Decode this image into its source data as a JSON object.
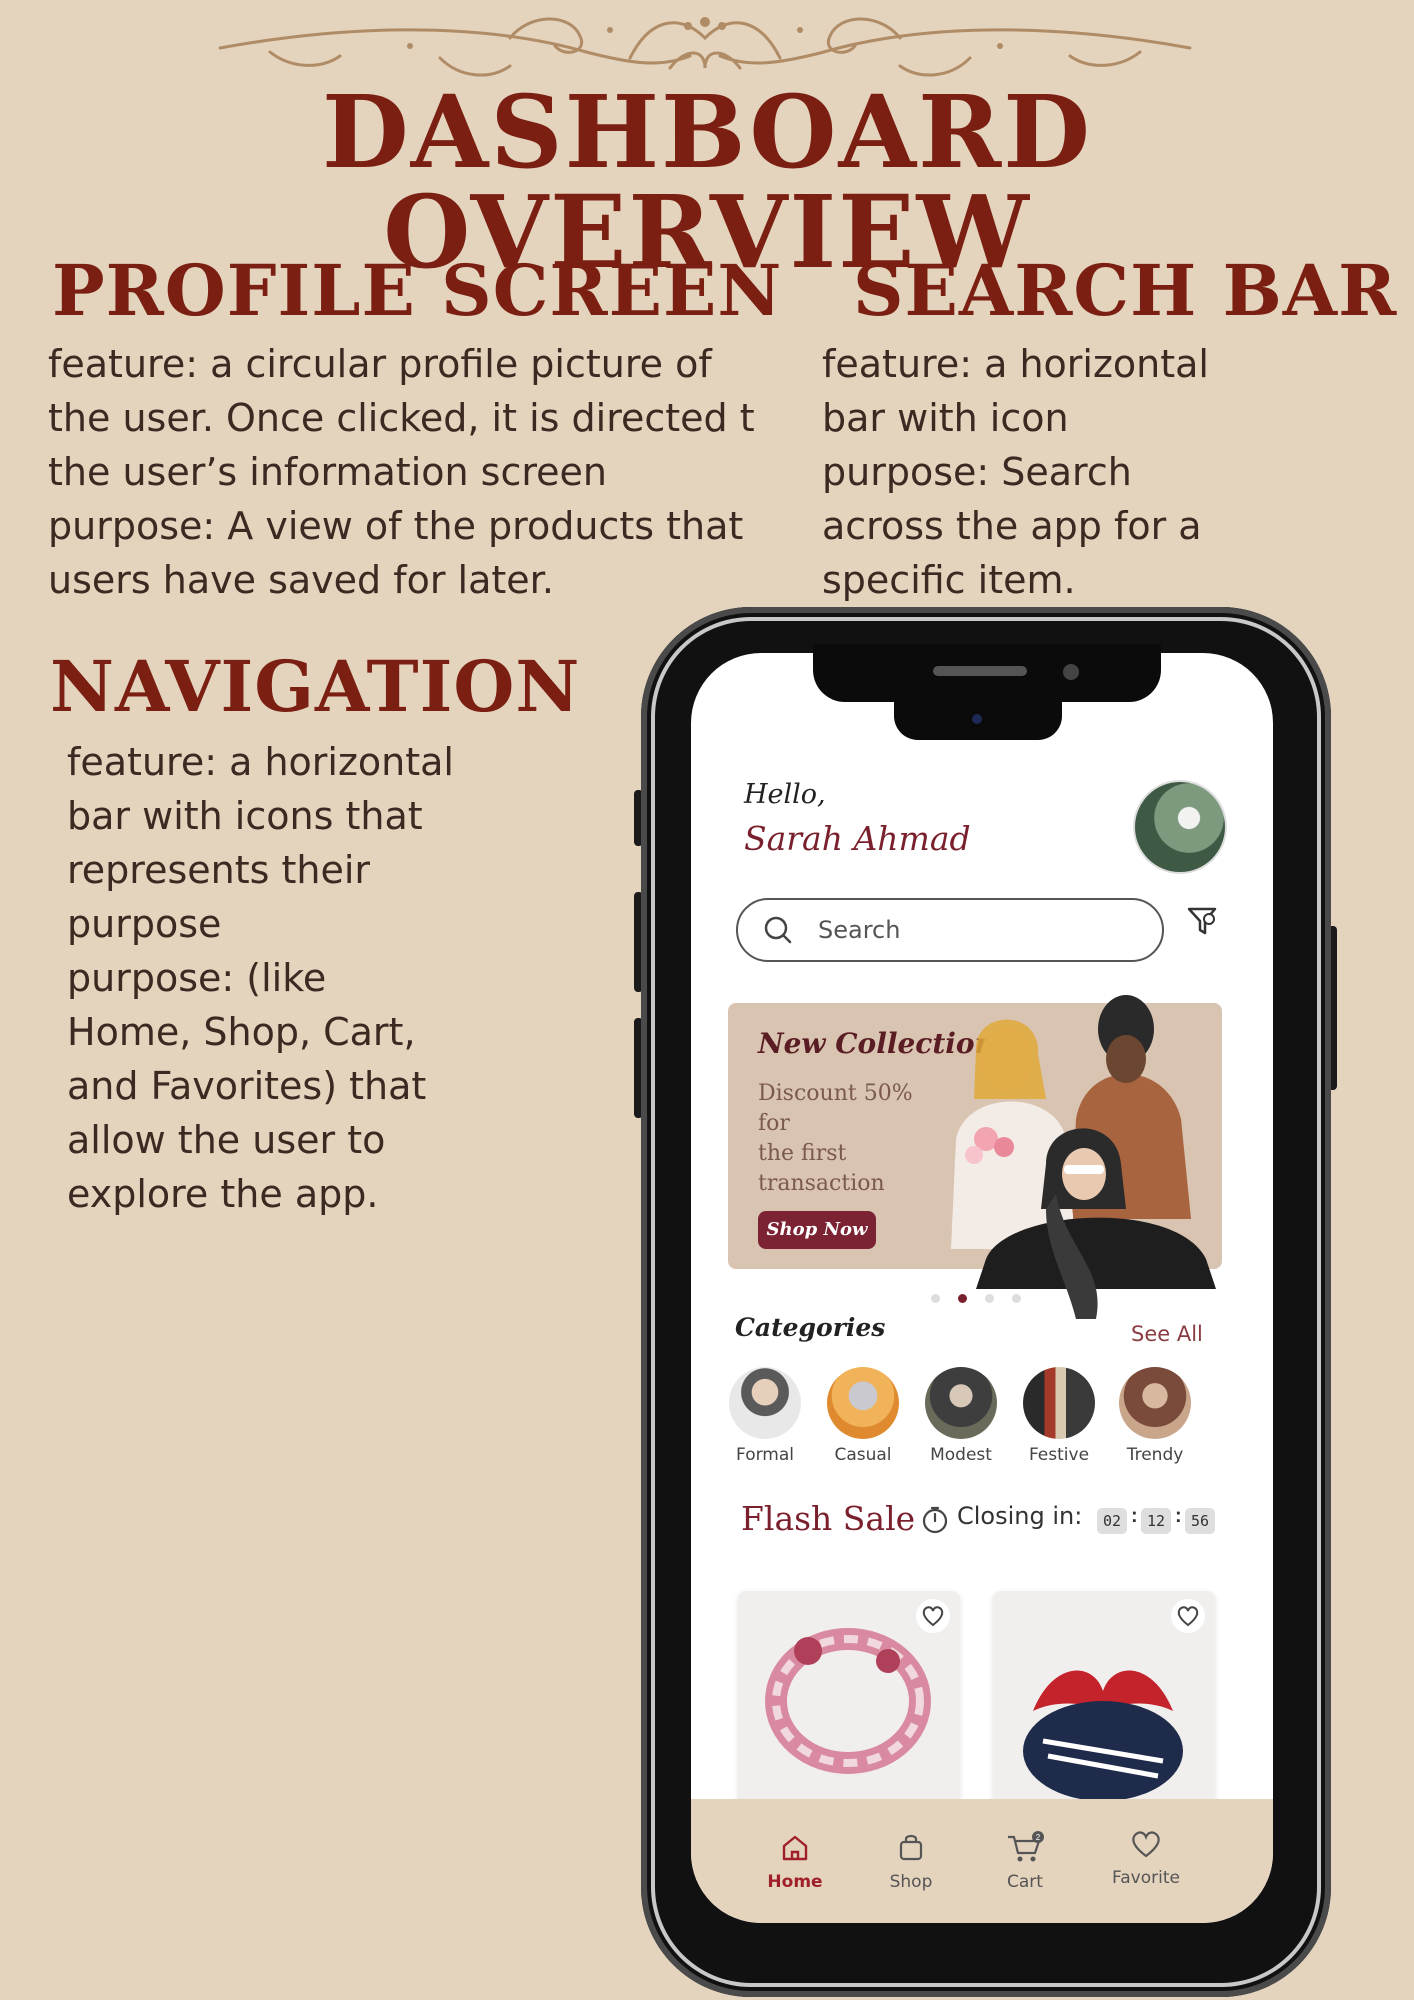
{
  "header": {
    "title": "DASHBOARD OVERVIEW"
  },
  "sections": {
    "profile": {
      "title": "PROFILE SCREEN",
      "lines": [
        "feature: a circular profile picture of",
        "the user. Once clicked, it is directed t",
        "the user’s information screen",
        "purpose: A view of the products that",
        "users have saved for later."
      ]
    },
    "search": {
      "title": "SEARCH BAR",
      "lines": [
        "feature: a horizontal",
        "bar with icon",
        "purpose: Search",
        "across the app for a",
        "specific item."
      ]
    },
    "navigation": {
      "title": "NAVIGATION",
      "lines": [
        "feature: a horizontal",
        "bar with icons that",
        "represents their",
        "purpose",
        "purpose: (like",
        "Home, Shop, Cart,",
        "and Favorites) that",
        "allow the user to",
        "explore the app."
      ]
    }
  },
  "app": {
    "greeting": "Hello,",
    "user_name": "Sarah Ahmad",
    "search_placeholder": "Search",
    "banner": {
      "title": "New Collection",
      "text": [
        "Discount 50%",
        "for",
        "the first",
        "transaction"
      ],
      "button": "Shop Now",
      "dots": 4,
      "active_dot": 2
    },
    "categories": {
      "title": "Categories",
      "see_all": "See All",
      "items": [
        "Formal",
        "Casual",
        "Modest",
        "Festive",
        "Trendy"
      ]
    },
    "flash_sale": {
      "title": "Flash Sale",
      "closing_label": "Closing in:",
      "hours": "02",
      "minutes": "12",
      "seconds": "56"
    },
    "nav": [
      {
        "label": "Home",
        "icon": "home-icon",
        "active": true
      },
      {
        "label": "Shop",
        "icon": "shopping-bag-icon",
        "active": false
      },
      {
        "label": "Cart",
        "icon": "cart-icon",
        "active": false,
        "badge": "2"
      },
      {
        "label": "Favorite",
        "icon": "heart-icon",
        "active": false
      }
    ]
  },
  "colors": {
    "background": "#e4d3bd",
    "title": "#7a1f12",
    "accent": "#7a1f2c"
  }
}
